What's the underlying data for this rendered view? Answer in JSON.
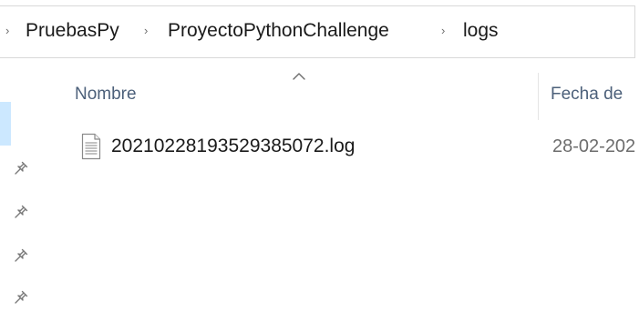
{
  "breadcrumb": {
    "items": [
      "PruebasPy",
      "ProyectoPythonChallenge",
      "logs"
    ],
    "separator": "›"
  },
  "columns": {
    "name_label": "Nombre",
    "date_label": "Fecha de",
    "sort_indicator": "ascending"
  },
  "files": [
    {
      "name": "20210228193529385072.log",
      "date": "28-02-202",
      "icon": "text-document-icon"
    }
  ],
  "nav_pane": {
    "pinned_icons": [
      "pin-icon",
      "pin-icon",
      "pin-icon",
      "pin-icon"
    ],
    "selected_color": "#cce8ff"
  },
  "colors": {
    "header_text": "#4c607a",
    "date_text": "#6d6d6d",
    "text": "#1a1a1a"
  }
}
